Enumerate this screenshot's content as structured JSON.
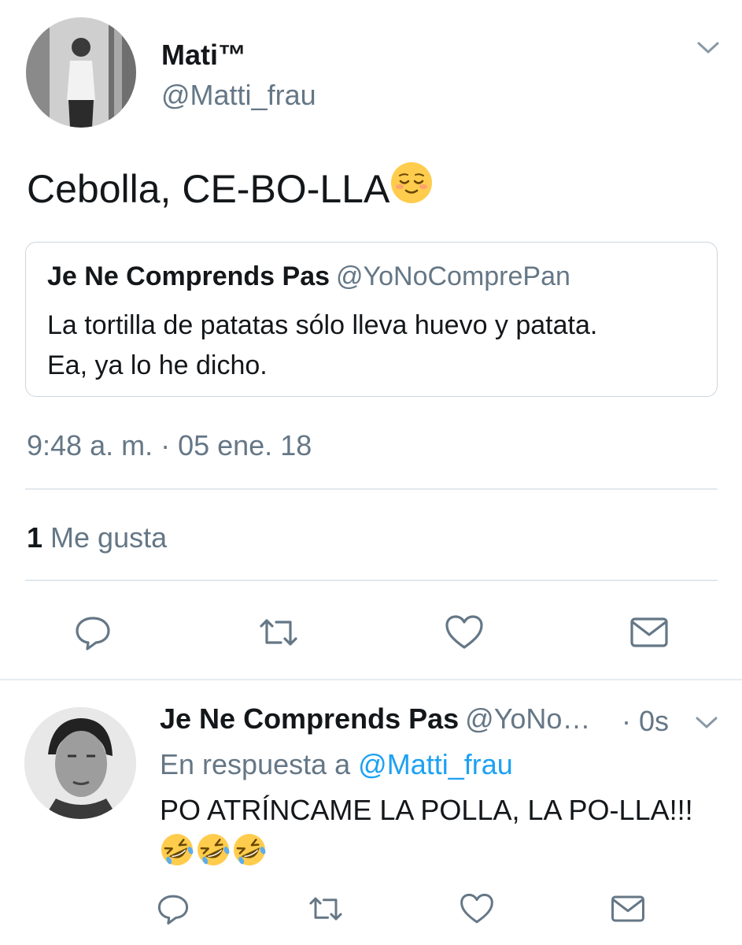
{
  "tweet": {
    "author_name": "Mati™",
    "author_handle": "@Matti_frau",
    "text": "Cebolla, CE-BO-LLA",
    "text_emoji": "relieved-face-emoji",
    "quoted": {
      "name": "Je Ne Comprends Pas",
      "handle": "@YoNoComprePan",
      "line1": "La tortilla de patatas sólo lleva huevo y patata.",
      "line2": "Ea, ya lo he dicho."
    },
    "timestamp": "9:48 a. m. · 05 ene. 18",
    "likes_count": "1",
    "likes_label": "Me gusta",
    "actions": [
      "reply-icon",
      "retweet-icon",
      "like-icon",
      "direct-message-icon"
    ]
  },
  "reply": {
    "author_name": "Je Ne Comprends Pas",
    "author_handle": "@YoNo…",
    "time": "· 0s",
    "in_reply_prefix": "En respuesta a",
    "in_reply_handle": "@Matti_frau",
    "text": "PO ATRÍNCAME LA POLLA, LA PO-LLA!!!",
    "emojis": [
      "rolling-on-floor-laughing-emoji",
      "rolling-on-floor-laughing-emoji",
      "rolling-on-floor-laughing-emoji"
    ],
    "actions": [
      "reply-icon",
      "retweet-icon",
      "like-icon",
      "direct-message-icon"
    ]
  },
  "colors": {
    "text": "#14171a",
    "muted": "#657786",
    "link": "#1da1f2",
    "border": "#ccd6dd",
    "divider": "#e1e8ed"
  }
}
